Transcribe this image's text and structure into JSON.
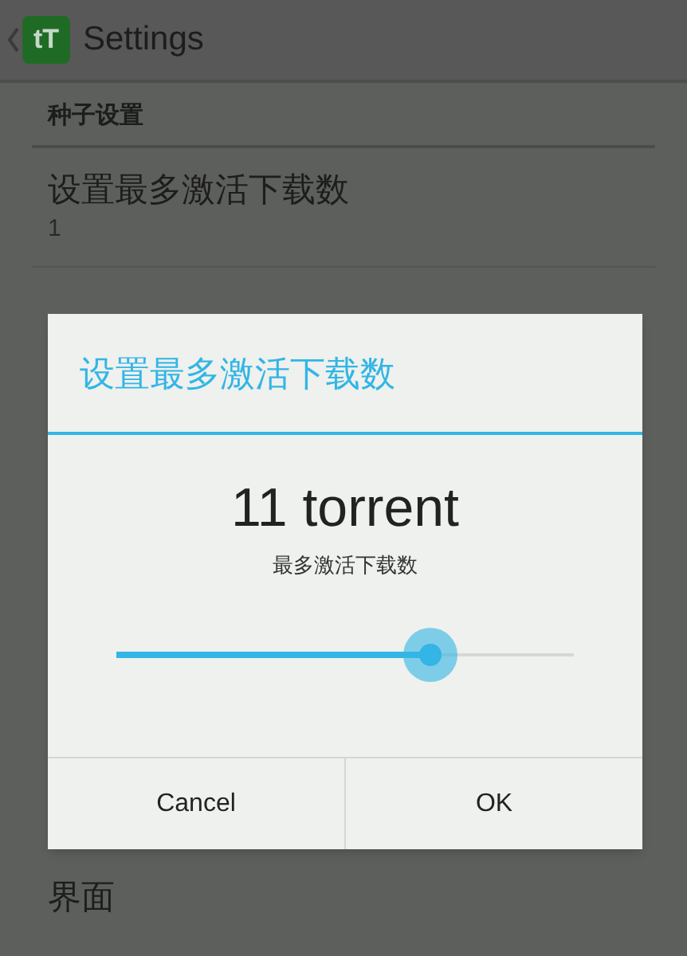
{
  "app_bar": {
    "logo": "tT",
    "title": "Settings"
  },
  "section": {
    "title": "种子设置"
  },
  "preferences": [
    {
      "title": "设置最多激活下载数",
      "summary": "1"
    }
  ],
  "next_section": {
    "title": "界面"
  },
  "dialog": {
    "title": "设置最多激活下载数",
    "value": "11 torrent",
    "caption": "最多激活下载数",
    "slider": {
      "level": 0.686
    },
    "buttons": [
      "Cancel",
      "OK"
    ]
  }
}
